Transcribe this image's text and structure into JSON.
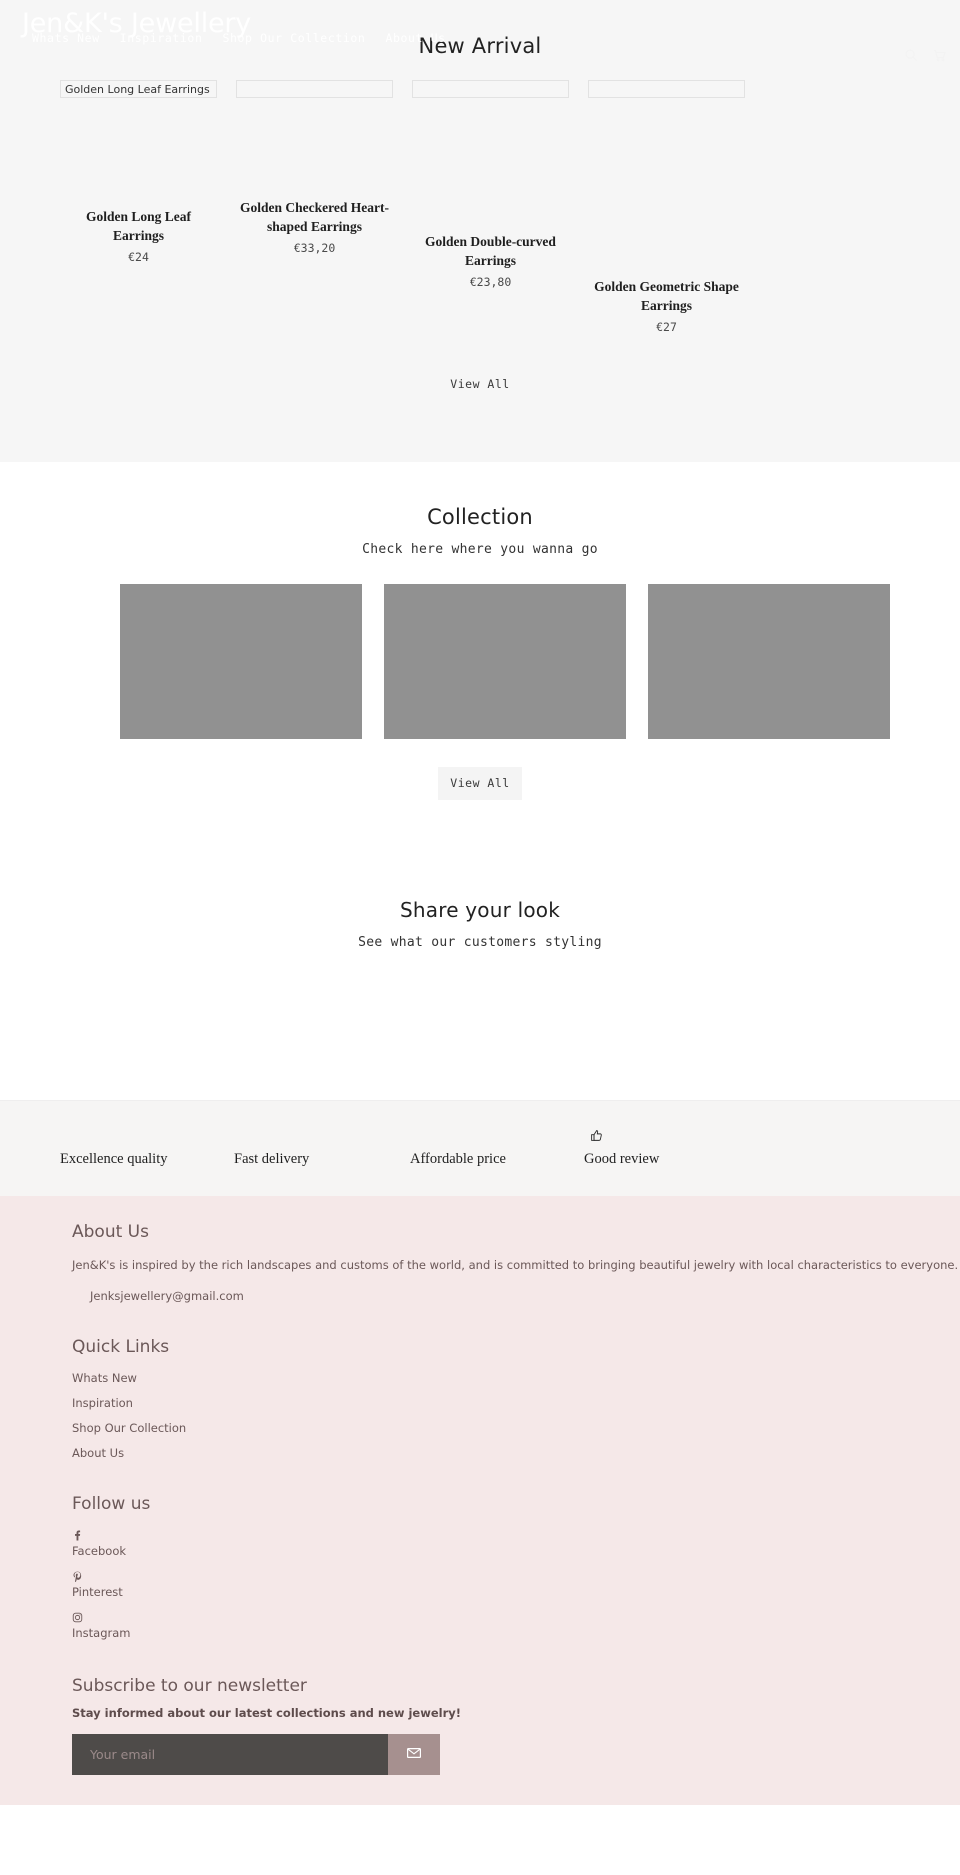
{
  "brand": {
    "logo": "Jen&K's Jewellery"
  },
  "header": {
    "nav": [
      {
        "label": "Whats New"
      },
      {
        "label": "Inspiration"
      },
      {
        "label": "Shop Our Collection"
      },
      {
        "label": "About Us"
      }
    ],
    "icons": [
      {
        "name": "search-icon"
      },
      {
        "name": "cart-icon"
      }
    ]
  },
  "new_arrival": {
    "title": "New Arrival",
    "view_all": "View All",
    "products": [
      {
        "alt": "Golden Long Leaf Earrings",
        "name": "Golden Long Leaf Earrings",
        "price": "€24"
      },
      {
        "alt": "",
        "name": "Golden Checkered Heart-shaped Earrings",
        "price": "€33,20"
      },
      {
        "alt": "",
        "name": "Golden Double-curved Earrings",
        "price": "€23,80"
      },
      {
        "alt": "",
        "name": "Golden Geometric Shape Earrings",
        "price": "€27"
      }
    ]
  },
  "collection": {
    "title": "Collection",
    "subtitle": "Check here where you wanna go",
    "view_all": "View All",
    "tiles": [
      {
        "name": "collection-tile-1"
      },
      {
        "name": "collection-tile-2"
      },
      {
        "name": "collection-tile-3"
      }
    ]
  },
  "share": {
    "title": "Share your look",
    "subtitle": "See what our customers styling"
  },
  "features": [
    {
      "label": "Excellence quality",
      "icon": null
    },
    {
      "label": "Fast delivery",
      "icon": null
    },
    {
      "label": "Affordable price",
      "icon": null
    },
    {
      "label": "Good review",
      "icon": "thumbs-up-icon"
    }
  ],
  "footer": {
    "about": {
      "title": "About Us",
      "text": "Jen&K's is inspired by the rich landscapes and customs of the world, and is committed to bringing beautiful jewelry with local characteristics to everyone.",
      "email": "Jenksjewellery@gmail.com"
    },
    "quick_links": {
      "title": "Quick Links",
      "items": [
        {
          "label": "Whats New"
        },
        {
          "label": "Inspiration"
        },
        {
          "label": "Shop Our Collection"
        },
        {
          "label": "About Us"
        }
      ]
    },
    "follow": {
      "title": "Follow us",
      "items": [
        {
          "label": "Facebook",
          "icon": "facebook-icon"
        },
        {
          "label": "Pinterest",
          "icon": "pinterest-icon"
        },
        {
          "label": "Instagram",
          "icon": "instagram-icon"
        }
      ]
    },
    "newsletter": {
      "title": "Subscribe to our newsletter",
      "subtitle": "Stay informed about our latest collections and new jewelry!",
      "placeholder": "Your email",
      "value": "",
      "submit_icon": "envelope-icon"
    }
  },
  "colors": {
    "band": "#f3e7e7",
    "footer_bg": "#f5e8e8",
    "accent": "#a6908f",
    "input_bg": "#4e4b49",
    "tile": "#919191",
    "section_bg": "#f6f6f6"
  }
}
